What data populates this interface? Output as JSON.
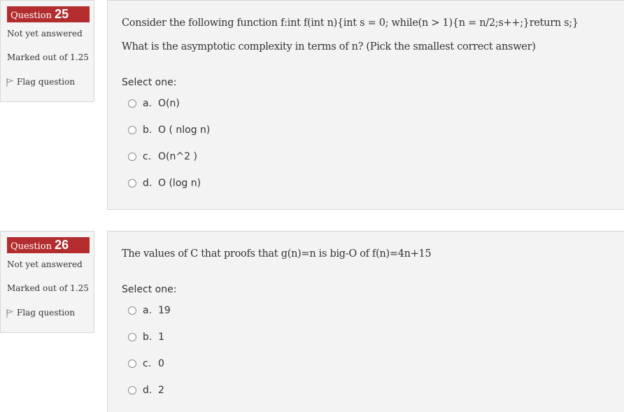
{
  "questions": [
    {
      "label": "Question",
      "number": "25",
      "state": "Not yet answered",
      "grade": "Marked out of 1.25",
      "flag": "Flag question",
      "text": [
        "Consider the following function f:int f(int n){int s = 0; while(n > 1){n = n/2;s++;}return s;}",
        "What is the asymptotic complexity in terms of n? (Pick the smallest correct answer)"
      ],
      "prompt": "Select one:",
      "options": [
        {
          "letter": "a.",
          "text": "O(n)"
        },
        {
          "letter": "b.",
          "text": "O ( nlog n)"
        },
        {
          "letter": "c.",
          "text": "O(n^2 )"
        },
        {
          "letter": "d.",
          "text": "O (log n)"
        }
      ]
    },
    {
      "label": "Question",
      "number": "26",
      "state": "Not yet answered",
      "grade": "Marked out of 1.25",
      "flag": "Flag question",
      "text": [
        "The values of C that proofs that g(n)=n is big-O of f(n)=4n+15"
      ],
      "prompt": "Select one:",
      "options": [
        {
          "letter": "a.",
          "text": "19"
        },
        {
          "letter": "b.",
          "text": "1"
        },
        {
          "letter": "c.",
          "text": "0"
        },
        {
          "letter": "d.",
          "text": "2"
        }
      ]
    }
  ],
  "colors": {
    "question_badge": "#b32d2e",
    "panel_background": "#f3f3f3",
    "info_background": "#f4f4f4",
    "border": "#d8d8d8",
    "text": "#333333"
  },
  "icons": {
    "flag": "flag-icon",
    "radio": "radio-unchecked-icon"
  }
}
